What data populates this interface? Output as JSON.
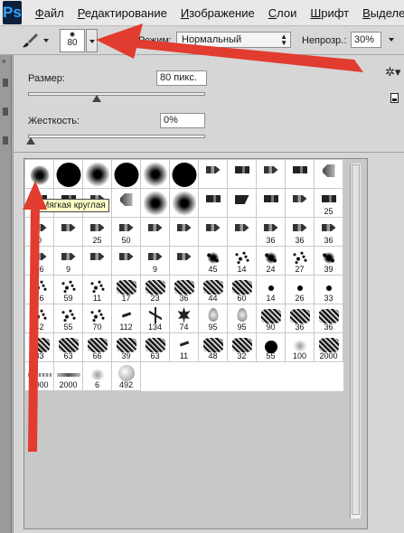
{
  "app": {
    "logo": "Ps"
  },
  "menu": [
    {
      "label": "Файл",
      "underline": "Ф",
      "rest": "айл"
    },
    {
      "label": "Редактирование",
      "underline": "Р",
      "rest": "едактирование"
    },
    {
      "label": "Изображение",
      "underline": "И",
      "rest": "зображение"
    },
    {
      "label": "Слои",
      "underline": "С",
      "rest": "лои"
    },
    {
      "label": "Шрифт",
      "underline": "Ш",
      "rest": "рифт"
    },
    {
      "label": "Выделени",
      "underline": "В",
      "rest": "ыделени"
    }
  ],
  "options": {
    "brush_size": "80",
    "mode_label": "Режим:",
    "mode_value": "Нормальный",
    "opacity_label": "Непрозр.:",
    "opacity_value": "30%"
  },
  "panel": {
    "size_label": "Размер:",
    "size_value": "80 пикс.",
    "size_percent": 0.4,
    "hardness_label": "Жесткость:",
    "hardness_value": "0%",
    "hardness_percent": 0,
    "tooltip": "Мягкая круглая"
  },
  "presets": [
    {
      "shape": "soft-dot",
      "label": ""
    },
    {
      "shape": "hard-dot",
      "label": ""
    },
    {
      "shape": "fuzzy",
      "label": ""
    },
    {
      "shape": "hard-dot",
      "label": ""
    },
    {
      "shape": "fuzzy",
      "label": ""
    },
    {
      "shape": "hard-dot",
      "label": ""
    },
    {
      "shape": "tip",
      "label": ""
    },
    {
      "shape": "tip-flat",
      "label": ""
    },
    {
      "shape": "tip",
      "label": ""
    },
    {
      "shape": "tip-flat",
      "label": ""
    },
    {
      "shape": "fan",
      "label": ""
    },
    {
      "shape": "tip-flat",
      "label": ""
    },
    {
      "shape": "tip-flat",
      "label": ""
    },
    {
      "shape": "tip",
      "label": ""
    },
    {
      "shape": "fan",
      "label": ""
    },
    {
      "shape": "fuzzy",
      "label": ""
    },
    {
      "shape": "fuzzy",
      "label": ""
    },
    {
      "shape": "tip-flat",
      "label": ""
    },
    {
      "shape": "wedge",
      "label": ""
    },
    {
      "shape": "tip-flat",
      "label": ""
    },
    {
      "shape": "tip",
      "label": ""
    },
    {
      "shape": "tip-flat",
      "label": "25"
    },
    {
      "shape": "tip",
      "label": "0"
    },
    {
      "shape": "tip",
      "label": ""
    },
    {
      "shape": "tip",
      "label": "25"
    },
    {
      "shape": "tip",
      "label": "50"
    },
    {
      "shape": "tip",
      "label": ""
    },
    {
      "shape": "tip",
      "label": ""
    },
    {
      "shape": "tip",
      "label": ""
    },
    {
      "shape": "tip",
      "label": ""
    },
    {
      "shape": "tip",
      "label": "36"
    },
    {
      "shape": "tip",
      "label": "36"
    },
    {
      "shape": "tip",
      "label": "36"
    },
    {
      "shape": "tip",
      "label": "36"
    },
    {
      "shape": "tip",
      "label": "9"
    },
    {
      "shape": "tip",
      "label": ""
    },
    {
      "shape": "tip",
      "label": ""
    },
    {
      "shape": "tip",
      "label": "9"
    },
    {
      "shape": "tip",
      "label": ""
    },
    {
      "shape": "splat",
      "label": "45"
    },
    {
      "shape": "speckle",
      "label": "14"
    },
    {
      "shape": "splat",
      "label": "24"
    },
    {
      "shape": "speckle",
      "label": "27"
    },
    {
      "shape": "splat",
      "label": "39"
    },
    {
      "shape": "speckle",
      "label": "46"
    },
    {
      "shape": "speckle",
      "label": "59"
    },
    {
      "shape": "speckle",
      "label": "11"
    },
    {
      "shape": "texture",
      "label": "17"
    },
    {
      "shape": "texture",
      "label": "23"
    },
    {
      "shape": "texture",
      "label": "36"
    },
    {
      "shape": "texture",
      "label": "44"
    },
    {
      "shape": "texture",
      "label": "60"
    },
    {
      "shape": "small-dot",
      "label": "14"
    },
    {
      "shape": "small-dot",
      "label": "26"
    },
    {
      "shape": "small-dot",
      "label": "33"
    },
    {
      "shape": "speckle",
      "label": "42"
    },
    {
      "shape": "speckle",
      "label": "55"
    },
    {
      "shape": "speckle",
      "label": "70"
    },
    {
      "shape": "dash",
      "label": "112"
    },
    {
      "shape": "grass",
      "label": "134"
    },
    {
      "shape": "leaf",
      "label": "74"
    },
    {
      "shape": "drop",
      "label": "95"
    },
    {
      "shape": "drop",
      "label": "95"
    },
    {
      "shape": "texture",
      "label": "90"
    },
    {
      "shape": "texture",
      "label": "36"
    },
    {
      "shape": "texture",
      "label": "36"
    },
    {
      "shape": "texture",
      "label": "33"
    },
    {
      "shape": "texture",
      "label": "63"
    },
    {
      "shape": "texture",
      "label": "66"
    },
    {
      "shape": "texture",
      "label": "39"
    },
    {
      "shape": "texture",
      "label": "63"
    },
    {
      "shape": "dash",
      "label": "11"
    },
    {
      "shape": "texture",
      "label": "48"
    },
    {
      "shape": "texture",
      "label": "32"
    },
    {
      "shape": "small-hard",
      "label": "55"
    },
    {
      "shape": "faint",
      "label": "100"
    },
    {
      "shape": "texture",
      "label": "2000"
    },
    {
      "shape": "line-stroke2",
      "label": "2000"
    },
    {
      "shape": "line-stroke",
      "label": "2000"
    },
    {
      "shape": "faint",
      "label": "6"
    },
    {
      "shape": "sphere",
      "label": "492"
    }
  ]
}
